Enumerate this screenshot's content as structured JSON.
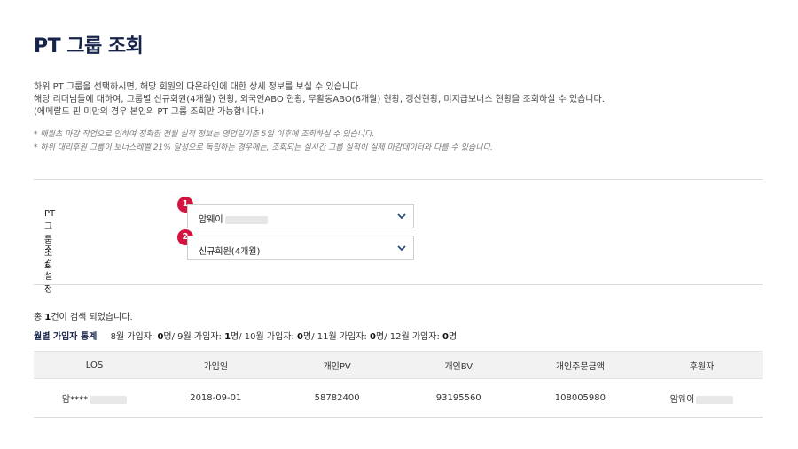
{
  "page": {
    "title": "PT 그룹 조회",
    "description": [
      "하위 PT 그룹을 선택하시면, 해당 회원의 다운라인에 대한 상세 정보를 보실 수 있습니다.",
      "해당 리더님들에 대하여, 그룹별 신규회원(4개월) 현황, 외국인ABO 현황, 무활동ABO(6개월) 현황, 갱신현황, 미지급보너스 현황을 조회하실 수 있습니다.",
      "(에메랄드 핀 미만의 경우 본인의 PT 그룹 조회만 가능합니다.)"
    ],
    "notes": [
      "매월초 마감 작업으로 인하여 정확한 전월 실적 정보는 영업일기준 5일 이후에 조회하실 수 있습니다.",
      "하위 대리후원 그룹이 보너스레벨 21% 달성으로 독립하는 경우에는, 조회되는 실시간 그룹 실적이 실제 마감데이터와 다를 수 있습니다."
    ]
  },
  "form": {
    "group": {
      "label": "PT 그룹 조회",
      "value": "암웨이",
      "badge": "1"
    },
    "condition": {
      "label": "조건 설정",
      "value": "신규회원(4개월)",
      "badge": "2"
    }
  },
  "results": {
    "count_prefix": "총 ",
    "count": "1",
    "count_suffix": "건이 검색 되었습니다."
  },
  "stats": {
    "label": "월별 가입자 통계",
    "months": [
      {
        "label": "8월 가입자: ",
        "value": "0",
        "unit": "명/ "
      },
      {
        "label": "9월 가입자: ",
        "value": "1",
        "unit": "명/ "
      },
      {
        "label": "10월 가입자: ",
        "value": "0",
        "unit": "명/ "
      },
      {
        "label": "11월 가입자: ",
        "value": "0",
        "unit": "명/ "
      },
      {
        "label": "12월 가입자: ",
        "value": "0",
        "unit": "명"
      }
    ]
  },
  "table": {
    "headers": [
      "LOS",
      "가입일",
      "개인PV",
      "개인BV",
      "개인주문금액",
      "후원자"
    ],
    "rows": [
      [
        "암****",
        "2018-09-01",
        "58782400",
        "93195560",
        "108005980",
        "암웨이"
      ]
    ]
  },
  "colors": {
    "title": "#17244a",
    "badge": "#d3143f",
    "chevron": "#2a4a7a",
    "header_bg": "#f2f2f2"
  },
  "icons": {
    "select_chevron": "chevron-down-icon"
  }
}
